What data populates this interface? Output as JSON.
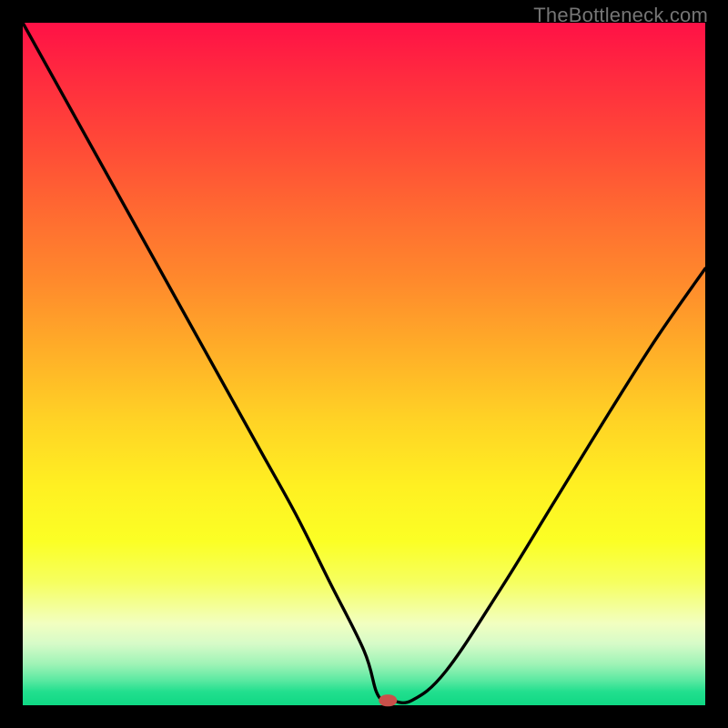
{
  "watermark": "TheBottleneck.com",
  "colors": {
    "background": "#000000",
    "stroke": "#000000",
    "marker": "#c9504a"
  },
  "chart_data": {
    "type": "line",
    "title": "",
    "xlabel": "",
    "ylabel": "",
    "xlim": [
      0,
      100
    ],
    "ylim": [
      0,
      100
    ],
    "grid": false,
    "series": [
      {
        "name": "curve",
        "x": [
          0,
          5,
          10,
          15,
          20,
          25,
          30,
          35,
          40,
          45,
          50,
          51.8,
          53,
          54,
          57,
          62,
          70,
          78,
          86,
          93,
          100
        ],
        "values": [
          100,
          91,
          82,
          73,
          64,
          55,
          46,
          37,
          28,
          18,
          8,
          2,
          0.7,
          0.7,
          0.7,
          5,
          17,
          30,
          43,
          54,
          64
        ]
      }
    ],
    "marker": {
      "x": 53.5,
      "y": 0.7
    }
  }
}
